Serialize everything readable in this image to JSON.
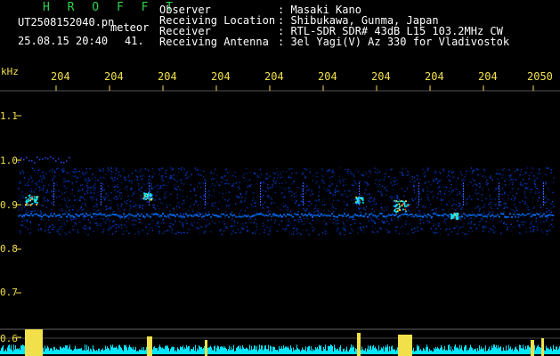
{
  "header": {
    "brand": "H R O F F T",
    "filename": "UT2508152040.pn",
    "detection_type": "meteor",
    "datetime": "25.08.15 20:40",
    "count": "41.",
    "fields": [
      {
        "label": "Observer",
        "value": ": Masaki Kano"
      },
      {
        "label": "Receiving Location",
        "value": ": Shibukawa, Gunma, Japan"
      },
      {
        "label": "Receiver",
        "value": ": RTL-SDR SDR# 43dB L15 103.2MHz CW"
      },
      {
        "label": "Receiving Antenna",
        "value": ": 3el Yagi(V) Az 330 for Vladivostok"
      }
    ]
  },
  "axes": {
    "y_unit": "kHz",
    "y_ticks": [
      "1.1",
      "1.0",
      "0.9",
      "0.8",
      "0.7",
      "0.6"
    ],
    "x_ticks": [
      "204",
      "204",
      "204",
      "204",
      "204",
      "204",
      "204",
      "204",
      "204",
      "2050"
    ]
  },
  "colors": {
    "header_green": "#2fd24a",
    "label_white": "#ffffff",
    "axis_yellow": "#f2e04a",
    "signal_blue": "#1a2cff",
    "noise_cyan": "#00e5ff"
  }
}
